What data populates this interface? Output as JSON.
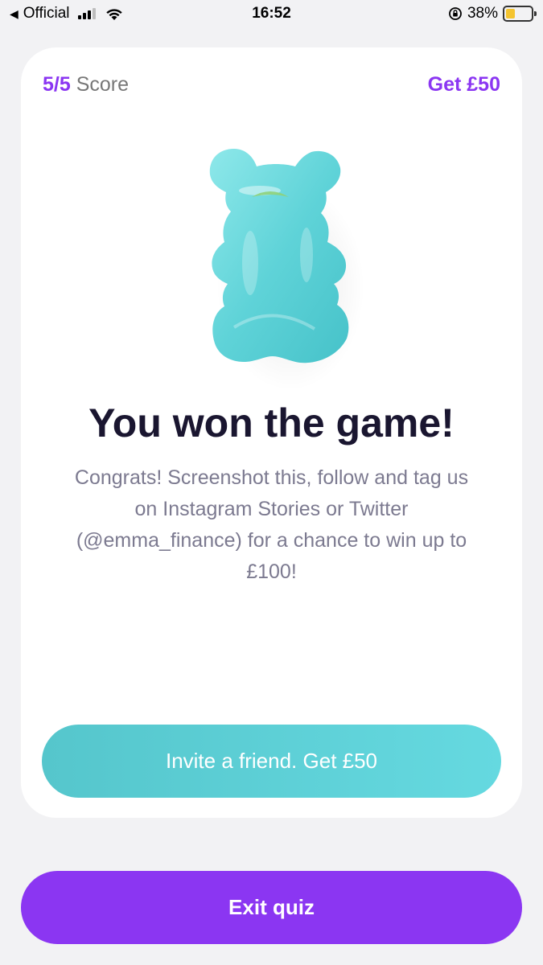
{
  "status_bar": {
    "carrier": "Official",
    "time": "16:52",
    "battery_percent": "38%",
    "battery_level": 0.38,
    "icons": [
      "back-arrow-icon",
      "signal-icon",
      "wifi-icon",
      "orientation-lock-icon",
      "battery-icon"
    ]
  },
  "card": {
    "score_value": "5/5",
    "score_label": "Score",
    "get_link": "Get £50",
    "image": "gummy-bear-icon",
    "title": "You won the game!",
    "description": "Congrats! Screenshot this, follow and tag us on Instagram Stories or Twitter (@emma_finance) for a chance to win up to £100!",
    "invite_button": "Invite a friend. Get £50"
  },
  "exit_button": "Exit quiz",
  "colors": {
    "accent_purple": "#8b36f2",
    "teal": "#5ccfd6",
    "background": "#f2f2f4"
  }
}
